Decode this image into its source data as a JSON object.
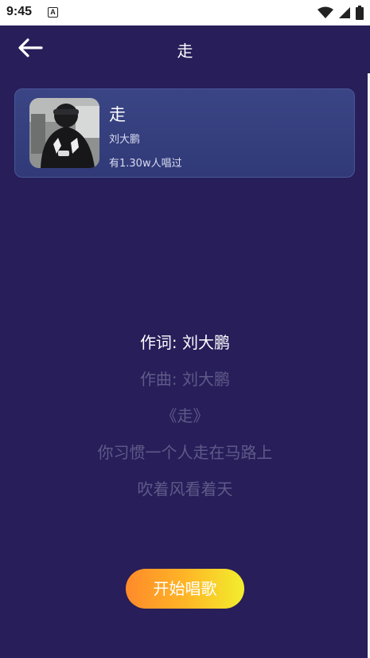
{
  "status_bar": {
    "time": "9:45",
    "notification_glyph": "A"
  },
  "nav": {
    "back_icon": "arrow-left-icon",
    "title": "走"
  },
  "song": {
    "title": "走",
    "artist": "刘大鹏",
    "sung_count": "有1.30w人唱过"
  },
  "lyrics": [
    "作词: 刘大鹏",
    "作曲: 刘大鹏",
    "《走》",
    "你习惯一个人走在马路上",
    "吹着风看着天"
  ],
  "actions": {
    "start_label": "开始唱歌"
  },
  "colors": {
    "background": "#271e5a",
    "card": "#343d7b",
    "lyric_active": "#ffffff",
    "lyric_inactive": "#5f5a88",
    "button_gradient_start": "#ff8a2a",
    "button_gradient_end": "#f2ee2e"
  }
}
